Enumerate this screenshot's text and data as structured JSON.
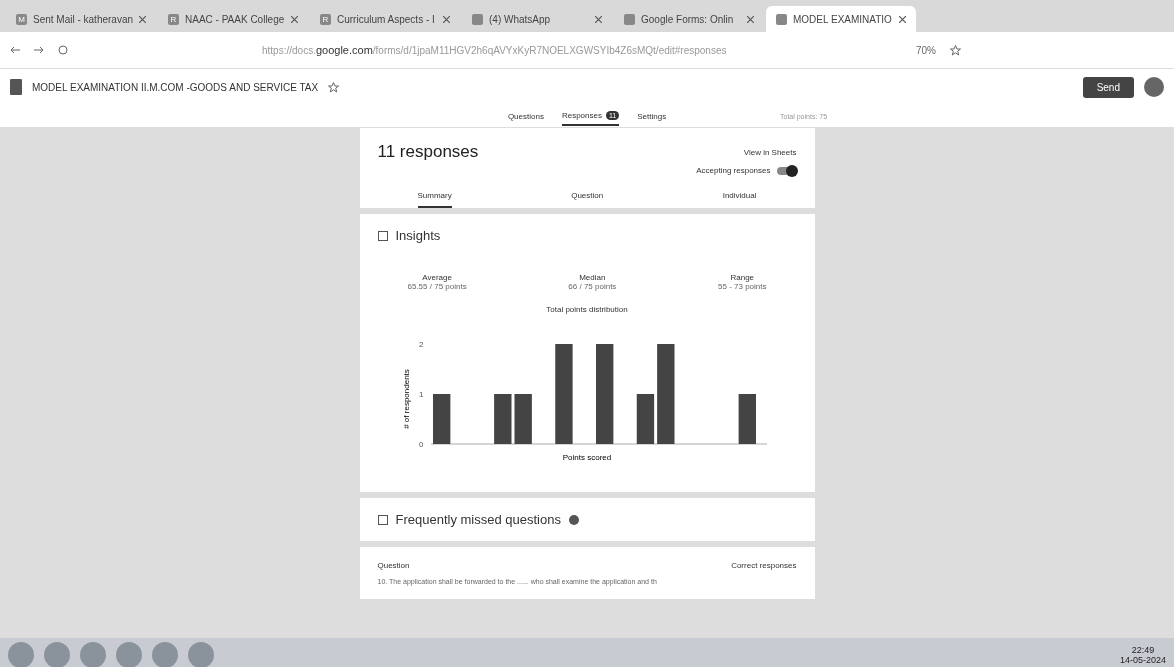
{
  "browser_tabs": [
    {
      "label": "Sent Mail - katheravan",
      "icon": "M",
      "selected": false
    },
    {
      "label": "NAAC - PAAK College",
      "icon": "R",
      "selected": false
    },
    {
      "label": "Curriculum Aspects - I",
      "icon": "R",
      "selected": false
    },
    {
      "label": "(4) WhatsApp",
      "selected": false
    },
    {
      "label": "Google Forms: Onlin",
      "selected": false
    },
    {
      "label": "MODEL EXAMINATIO",
      "selected": true
    }
  ],
  "address_bar": {
    "url_prefix": "https://docs.",
    "url_domain": "google.com",
    "url_rest": "/forms/d/1jpaM11HGV2h6qAVYxKyR7NOELXGWSYIb4Z6sMQt/edit#responses",
    "zoom": "70%"
  },
  "form_header": {
    "title": "MODEL EXAMINATION II.M.COM -GOODS AND SERVICE TAX",
    "send": "Send"
  },
  "form_tabs": [
    {
      "label": "Questions",
      "selected": false
    },
    {
      "label": "Responses",
      "badge": "11",
      "selected": true
    },
    {
      "label": "Settings",
      "selected": false
    }
  ],
  "total_points": "Total points: 75",
  "responses": {
    "title": "11 responses",
    "view_in_sheets": "View in Sheets",
    "accepting_label": "Accepting responses",
    "accepting": true
  },
  "response_tabs": [
    {
      "label": "Summary",
      "selected": true
    },
    {
      "label": "Question",
      "selected": false
    },
    {
      "label": "Individual",
      "selected": false
    }
  ],
  "insights": {
    "title": "Insights",
    "stats": [
      {
        "label": "Average",
        "value": "65.55 / 75 points"
      },
      {
        "label": "Median",
        "value": "66 / 75 points"
      },
      {
        "label": "Range",
        "value": "55 - 73 points"
      }
    ],
    "chart_data": {
      "type": "bar",
      "title": "Total points distribution",
      "xlabel": "Points scored",
      "ylabel": "# of respondents",
      "yticks": [
        0,
        1,
        2
      ],
      "ylim": [
        0,
        2
      ],
      "values": [
        1,
        null,
        null,
        1,
        1,
        null,
        2,
        null,
        2,
        null,
        1,
        2,
        null,
        null,
        null,
        1
      ]
    }
  },
  "missed": {
    "title": "Frequently missed questions",
    "col_question": "Question",
    "col_correct": "Correct responses",
    "row": "10. The application shall be forwarded to the ...... who shall examine the application and th"
  },
  "clock": {
    "time": "22:49",
    "date": "14-05-2024"
  }
}
